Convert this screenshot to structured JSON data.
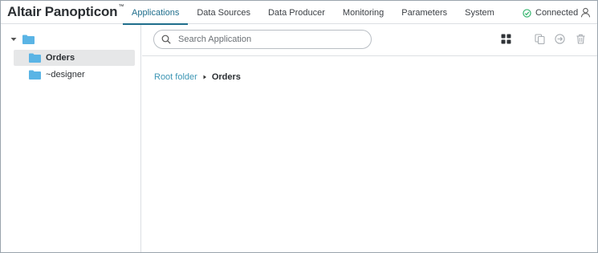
{
  "app": {
    "brand": "Altair Panopticon",
    "trademark": "™"
  },
  "nav": {
    "tabs": [
      {
        "label": "Applications",
        "active": true
      },
      {
        "label": "Data Sources",
        "active": false
      },
      {
        "label": "Data Producer",
        "active": false
      },
      {
        "label": "Monitoring",
        "active": false
      },
      {
        "label": "Parameters",
        "active": false
      },
      {
        "label": "System",
        "active": false
      }
    ]
  },
  "status": {
    "label": "Connected",
    "icon": "check-circle-icon",
    "color": "#2fb36a"
  },
  "user": {
    "icon": "user-icon"
  },
  "sidebar": {
    "root_icon": "folder-icon",
    "items": [
      {
        "label": "Orders",
        "selected": true,
        "icon": "folder-icon"
      },
      {
        "label": "~designer",
        "selected": false,
        "icon": "folder-icon"
      }
    ]
  },
  "toolbar": {
    "search_placeholder": "Search Application",
    "icons": [
      "grid-view-icon",
      "copy-icon",
      "move-icon",
      "delete-icon"
    ]
  },
  "breadcrumb": {
    "root": "Root folder",
    "current": "Orders"
  },
  "colors": {
    "accent": "#1f6e8c",
    "link": "#3f97b5",
    "folder": "#5ab4e5"
  }
}
